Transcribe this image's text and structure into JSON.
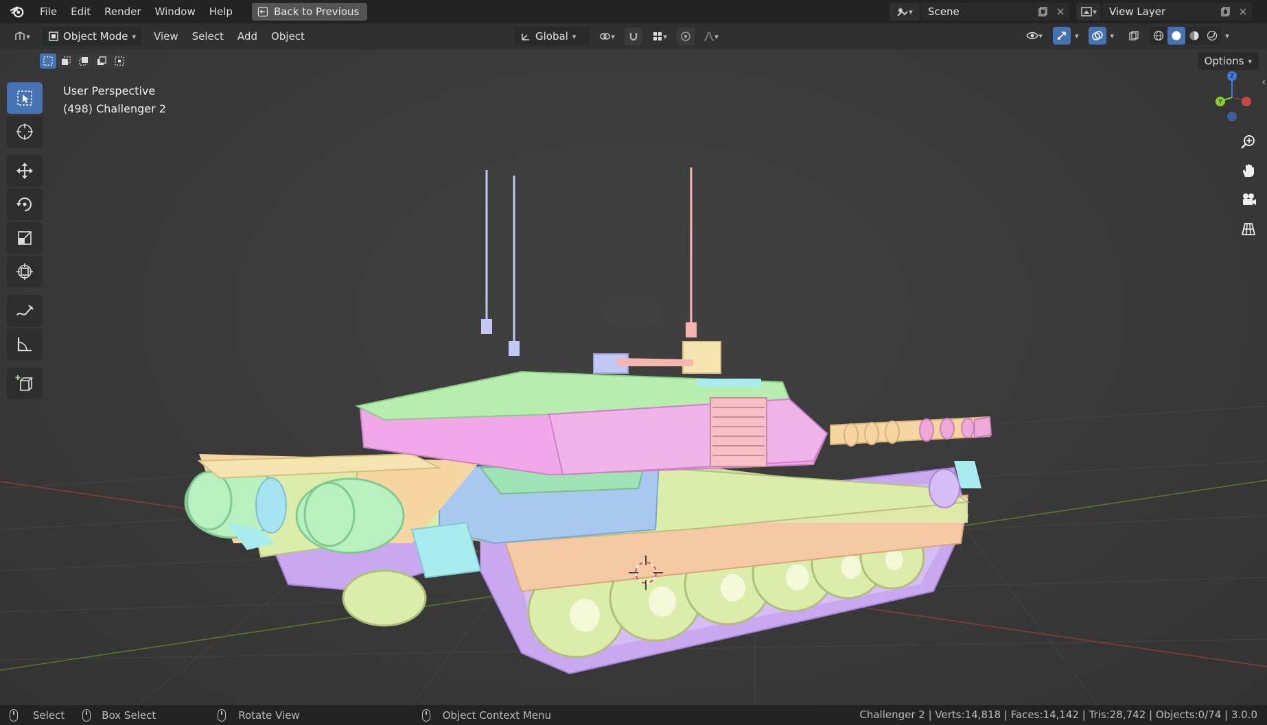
{
  "topbar": {
    "menu": [
      "File",
      "Edit",
      "Render",
      "Window",
      "Help"
    ],
    "back_label": "Back to Previous",
    "scene": "Scene",
    "view_layer": "View Layer"
  },
  "header": {
    "mode": "Object Mode",
    "menu": [
      "View",
      "Select",
      "Add",
      "Object"
    ],
    "orientation": "Global"
  },
  "viewport": {
    "perspective": "User Perspective",
    "object_info": "(498) Challenger 2",
    "options_label": "Options"
  },
  "status": {
    "select": "Select",
    "box_select": "Box Select",
    "rotate": "Rotate View",
    "context": "Object Context Menu",
    "stats": "Challenger 2 | Verts:14,818 | Faces:14,142 | Tris:28,742 | Objects:0/74 | 3.0.0"
  },
  "colors": {
    "accent": "#4772b3",
    "green_pastel": "#c9f0a8",
    "pink_pastel": "#f0a8e8",
    "peach_pastel": "#f5c9a3",
    "blue_pastel": "#a8c8f0",
    "lavender": "#c9a8f0",
    "cyan": "#a8ecf0"
  },
  "icons": [
    "blender-logo-icon",
    "back-icon",
    "cursor-icon",
    "move-icon",
    "rotate-icon",
    "scale-icon",
    "transform-icon",
    "annotate-icon",
    "measure-icon",
    "add-cube-icon",
    "zoom-icon",
    "hand-icon",
    "camera-icon",
    "grid-icon"
  ]
}
